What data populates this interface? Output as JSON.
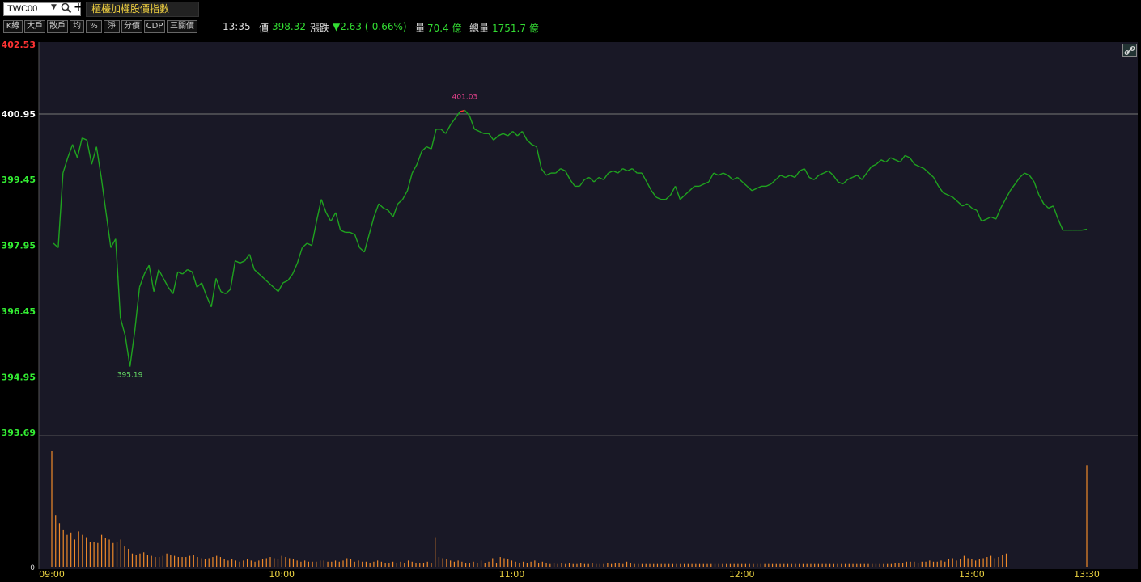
{
  "header": {
    "symbol": "TWC00",
    "title": "櫃檯加權股價指數",
    "search_icon": "magnifier-icon",
    "add_icon": "plus-icon"
  },
  "toolbar": {
    "buttons": [
      "K線",
      "大戶",
      "散戶",
      "均",
      "%",
      "淨",
      "分價",
      "CDP",
      "三關價"
    ]
  },
  "quote": {
    "time": "13:35",
    "price_label": "價",
    "price": "398.32",
    "change_label": "漲跌",
    "change": "▼2.63 (-0.66%)",
    "volume_label": "量",
    "volume": "70.4 億",
    "total_volume_label": "總量",
    "total_volume": "1751.7 億"
  },
  "colors": {
    "line_up": "#ff3333",
    "line_down": "#1fa31f",
    "volume_bar": "#f08a2a",
    "axis_text_up": "#ff3333",
    "axis_text_down": "#33ee33",
    "axis_text_ref": "#ffffff",
    "time_label": "#e8d040",
    "high_label": "#e0408a",
    "low_label": "#66dd66"
  },
  "chart_data": {
    "type": "line",
    "y_ticks": [
      "402.53",
      "400.95",
      "399.45",
      "397.95",
      "396.45",
      "394.95",
      "393.69"
    ],
    "reference_price": 400.95,
    "ylim": [
      393.69,
      402.53
    ],
    "x_ticks": [
      "09:00",
      "10:00",
      "11:00",
      "12:00",
      "13:00",
      "13:30"
    ],
    "high_label": "401.03",
    "low_label": "395.19",
    "volume_zero_label": "0",
    "price_series": [
      398.0,
      397.9,
      399.6,
      399.95,
      400.25,
      399.95,
      400.4,
      400.35,
      399.8,
      400.2,
      399.5,
      398.7,
      397.9,
      398.1,
      396.3,
      395.9,
      395.19,
      396.0,
      397.0,
      397.3,
      397.5,
      396.9,
      397.4,
      397.2,
      397.0,
      396.85,
      397.35,
      397.3,
      397.4,
      397.35,
      397.0,
      397.1,
      396.8,
      396.55,
      397.2,
      396.9,
      396.85,
      396.95,
      397.6,
      397.55,
      397.6,
      397.75,
      397.4,
      397.3,
      397.2,
      397.1,
      397.0,
      396.9,
      397.1,
      397.15,
      397.3,
      397.55,
      397.9,
      398.0,
      397.95,
      398.5,
      399.0,
      398.7,
      398.5,
      398.7,
      398.3,
      398.25,
      398.25,
      398.2,
      397.9,
      397.8,
      398.2,
      398.6,
      398.9,
      398.8,
      398.75,
      398.6,
      398.9,
      399.0,
      399.2,
      399.6,
      399.8,
      400.1,
      400.2,
      400.15,
      400.6,
      400.6,
      400.5,
      400.7,
      400.85,
      401.0,
      401.03,
      400.9,
      400.6,
      400.55,
      400.5,
      400.5,
      400.35,
      400.45,
      400.5,
      400.45,
      400.55,
      400.45,
      400.55,
      400.35,
      400.25,
      400.2,
      399.7,
      399.55,
      399.6,
      399.6,
      399.7,
      399.65,
      399.45,
      399.3,
      399.3,
      399.45,
      399.5,
      399.4,
      399.5,
      399.45,
      399.6,
      399.65,
      399.6,
      399.7,
      399.65,
      399.7,
      399.6,
      399.6,
      399.4,
      399.2,
      399.05,
      399.0,
      399.0,
      399.1,
      399.3,
      399.0,
      399.1,
      399.2,
      399.3,
      399.3,
      399.35,
      399.4,
      399.6,
      399.55,
      399.6,
      399.55,
      399.45,
      399.5,
      399.4,
      399.3,
      399.2,
      399.25,
      399.3,
      399.3,
      399.35,
      399.45,
      399.55,
      399.5,
      399.55,
      399.5,
      399.65,
      399.7,
      399.5,
      399.45,
      399.55,
      399.6,
      399.65,
      399.55,
      399.4,
      399.35,
      399.45,
      399.5,
      399.55,
      399.45,
      399.6,
      399.75,
      399.8,
      399.9,
      399.85,
      399.95,
      399.9,
      399.85,
      400.0,
      399.95,
      399.8,
      399.75,
      399.7,
      399.6,
      399.5,
      399.3,
      399.15,
      399.1,
      399.05,
      398.95,
      398.85,
      398.9,
      398.8,
      398.75,
      398.5,
      398.55,
      398.6,
      398.55,
      398.8,
      399.0,
      399.2,
      399.35,
      399.5,
      399.6,
      399.55,
      399.4,
      399.1,
      398.9,
      398.8,
      398.85,
      398.55,
      398.3,
      398.3,
      398.3,
      398.3,
      398.3,
      398.32
    ],
    "volume_series": [
      100,
      45,
      38,
      32,
      28,
      30,
      24,
      31,
      28,
      26,
      22,
      22,
      21,
      28,
      25,
      24,
      21,
      22,
      24,
      18,
      16,
      12,
      11,
      12,
      13,
      11,
      10,
      9,
      9,
      10,
      12,
      11,
      10,
      9,
      9,
      9,
      10,
      11,
      9,
      8,
      7,
      8,
      9,
      10,
      9,
      7,
      6,
      7,
      6,
      5,
      6,
      7,
      6,
      5,
      6,
      7,
      8,
      9,
      8,
      7,
      10,
      9,
      8,
      7,
      6,
      5,
      6,
      5,
      5,
      5,
      6,
      6,
      5,
      5,
      6,
      5,
      6,
      8,
      7,
      5,
      6,
      5,
      5,
      4,
      5,
      6,
      5,
      4,
      4,
      5,
      4,
      5,
      4,
      6,
      5,
      4,
      4,
      4,
      5,
      4,
      26,
      9,
      8,
      7,
      6,
      5,
      6,
      5,
      4,
      4,
      5,
      4,
      6,
      4,
      5,
      8,
      4,
      9,
      8,
      7,
      6,
      5,
      4,
      5,
      4,
      5,
      6,
      4,
      5,
      4,
      3,
      4,
      3,
      4,
      3,
      4,
      3,
      3,
      4,
      3,
      3,
      4,
      3,
      3,
      3,
      4,
      3,
      4,
      4,
      3,
      5,
      4,
      3,
      3,
      3,
      3,
      3,
      3,
      3,
      3,
      3,
      3,
      3,
      3,
      3,
      3,
      3,
      3,
      3,
      3,
      3,
      3,
      3,
      3,
      3,
      3,
      3,
      3,
      3,
      3,
      3,
      3,
      3,
      3,
      3,
      3,
      3,
      3,
      3,
      3,
      3,
      3,
      3,
      3,
      3,
      3,
      3,
      3,
      3,
      3,
      3,
      3,
      3,
      3,
      3,
      3,
      3,
      3,
      3,
      3,
      3,
      3,
      3,
      3,
      3,
      3,
      3,
      3,
      3,
      3,
      4,
      4,
      4,
      5,
      5,
      5,
      4,
      5,
      5,
      6,
      5,
      5,
      6,
      5,
      7,
      8,
      6,
      7,
      10,
      8,
      7,
      6,
      7,
      8,
      9,
      10,
      8,
      9,
      11,
      12,
      0,
      0,
      0,
      0,
      0,
      0,
      0,
      0,
      0,
      0,
      0,
      0,
      0,
      0,
      0,
      0,
      0,
      0,
      0,
      0,
      88
    ]
  }
}
